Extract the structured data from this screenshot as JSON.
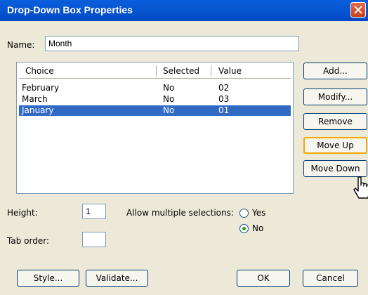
{
  "window": {
    "title": "Drop-Down Box Properties"
  },
  "name_field": {
    "label": "Name:",
    "value": "Month"
  },
  "choices": {
    "columns": [
      "Choice",
      "Selected",
      "Value"
    ],
    "rows": [
      {
        "choice": "February",
        "selected": "No",
        "value": "02"
      },
      {
        "choice": "March",
        "selected": "No",
        "value": "03"
      },
      {
        "choice": "January",
        "selected": "No",
        "value": "01",
        "highlighted": true
      }
    ]
  },
  "side_buttons": {
    "add": "Add...",
    "modify": "Modify...",
    "remove": "Remove",
    "move_up": "Move Up",
    "move_down": "Move Down"
  },
  "height_field": {
    "label": "Height:",
    "value": "1"
  },
  "tab_order_field": {
    "label": "Tab order:",
    "value": ""
  },
  "multiple_selections": {
    "label": "Allow multiple selections:",
    "options": [
      {
        "label": "Yes",
        "checked": false
      },
      {
        "label": "No",
        "checked": true
      }
    ]
  },
  "bottom_buttons": {
    "style": "Style...",
    "validate": "Validate...",
    "ok": "OK",
    "cancel": "Cancel"
  },
  "colors": {
    "titlebar": "#0349c3",
    "selection": "#316ac5",
    "dialog_bg": "#ece9d8"
  },
  "icons": {
    "close": "close-icon",
    "cursor": "hand-pointer-icon"
  }
}
